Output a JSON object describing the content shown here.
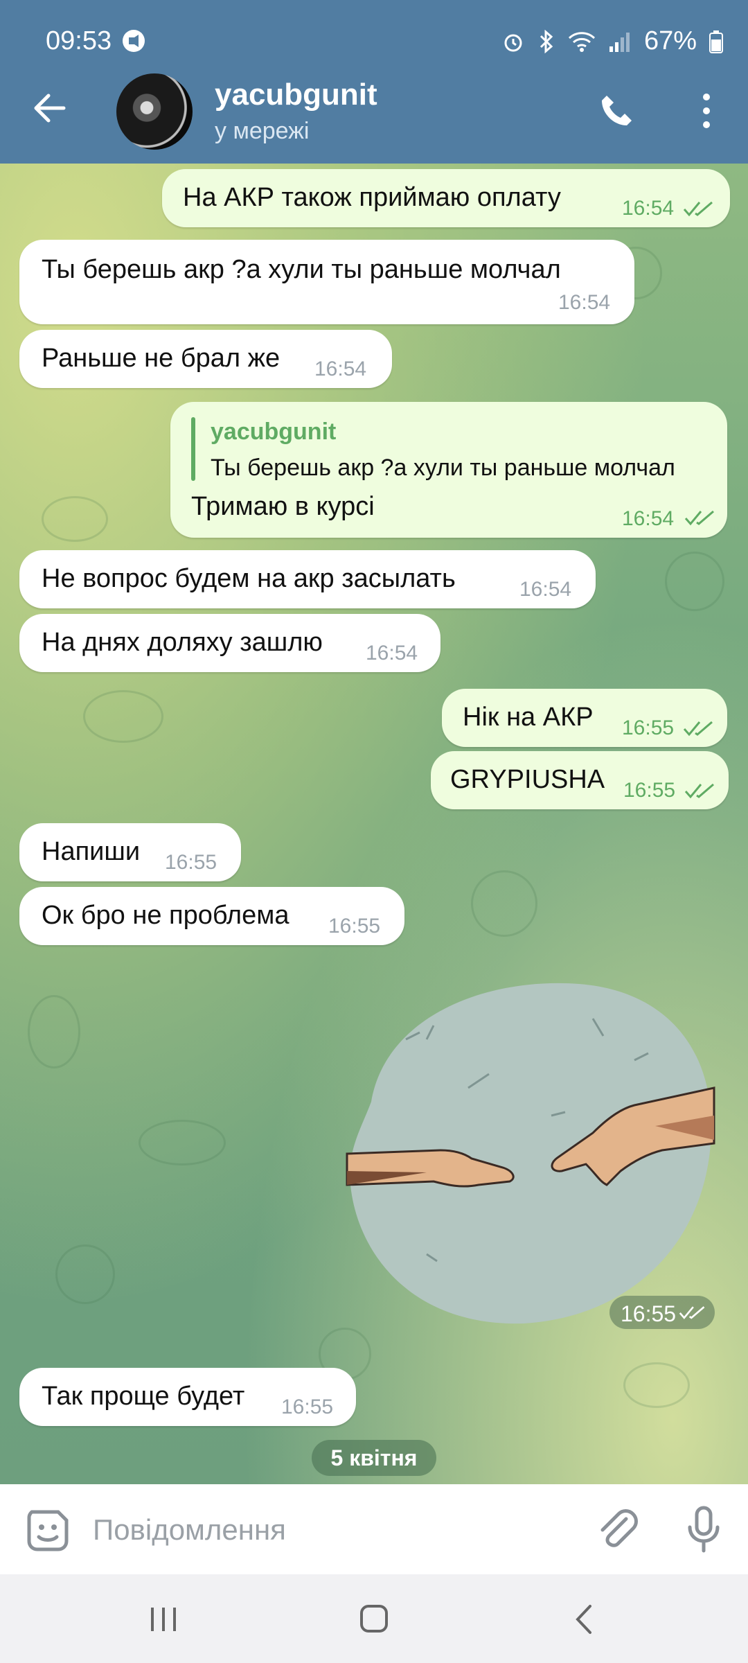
{
  "status_bar": {
    "time": "09:53",
    "battery": "67%"
  },
  "header": {
    "name": "yacubgunit",
    "status": "у мережі"
  },
  "messages": [
    {
      "dir": "out",
      "text": "На АКР також приймаю оплату",
      "time": "16:54"
    },
    {
      "dir": "in",
      "text": "Ты берешь акр ?а хули ты раньше молчал",
      "time": "16:54"
    },
    {
      "dir": "in",
      "text": "Раньше не брал же",
      "time": "16:54"
    },
    {
      "dir": "out",
      "reply_name": "yacubgunit",
      "reply_text": "Ты берешь акр ?а хули ты раньше молчал",
      "text": "Тримаю в курсі",
      "time": "16:54"
    },
    {
      "dir": "in",
      "text": "Не вопрос будем на акр засылать",
      "time": "16:54"
    },
    {
      "dir": "in",
      "text": "На днях доляху зашлю",
      "time": "16:54"
    },
    {
      "dir": "out",
      "text": "Нік на АКР",
      "time": "16:55"
    },
    {
      "dir": "out",
      "text": "GRYPIUSHA",
      "time": "16:55"
    },
    {
      "dir": "in",
      "text": "Напиши",
      "time": "16:55"
    },
    {
      "dir": "in",
      "text": "Ок бро не проблема",
      "time": "16:55"
    },
    {
      "dir": "out",
      "sticker": "hands-reaching-sticker",
      "time": "16:55"
    },
    {
      "dir": "in",
      "text": "Так проще будет",
      "time": "16:55"
    }
  ],
  "date_separator": "5 квітня",
  "composer": {
    "placeholder": "Повідомлення"
  },
  "colors": {
    "header": "#517da2",
    "out_bubble": "#effdde",
    "in_bubble": "#ffffff",
    "accent_green": "#5fab63"
  }
}
